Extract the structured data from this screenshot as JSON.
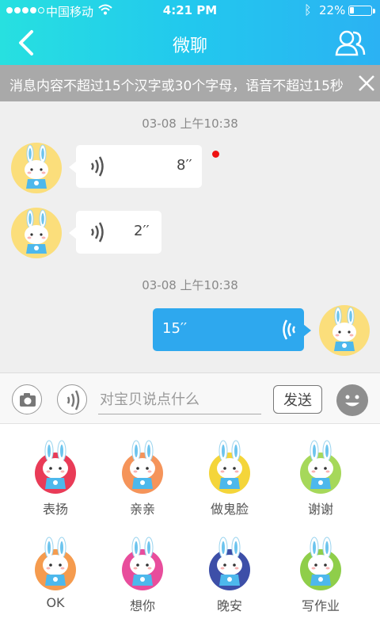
{
  "status_bar": {
    "carrier": "中国移动",
    "time": "4:21 PM",
    "battery": "22%",
    "battery_level": 0.22
  },
  "header": {
    "title": "微聊"
  },
  "notice": {
    "text": "消息内容不超过15个汉字或30个字母，语音不超过15秒"
  },
  "chat": {
    "timestamps": [
      "03-08 上午10:38",
      "03-08 上午10:38"
    ],
    "messages": [
      {
        "side": "left",
        "duration": "8′′",
        "unread": true
      },
      {
        "side": "left",
        "duration": "2′′",
        "unread": false
      },
      {
        "side": "right",
        "duration": "15′′",
        "unread": false
      }
    ]
  },
  "input": {
    "placeholder": "对宝贝说点什么",
    "send_label": "发送"
  },
  "stickers": [
    {
      "label": "表扬",
      "color": "#e93b57"
    },
    {
      "label": "亲亲",
      "color": "#f5945a"
    },
    {
      "label": "做鬼脸",
      "color": "#f4d53a"
    },
    {
      "label": "谢谢",
      "color": "#a6d85a"
    },
    {
      "label": "OK",
      "color": "#f59b4e"
    },
    {
      "label": "想你",
      "color": "#e84d9c"
    },
    {
      "label": "晚安",
      "color": "#3d4fa8"
    },
    {
      "label": "写作业",
      "color": "#8fce4a"
    }
  ],
  "colors": {
    "header_start": "#27e0e0",
    "header_end": "#2bb2f3",
    "my_bubble": "#2ea8ee",
    "unread_dot": "#e11111"
  }
}
